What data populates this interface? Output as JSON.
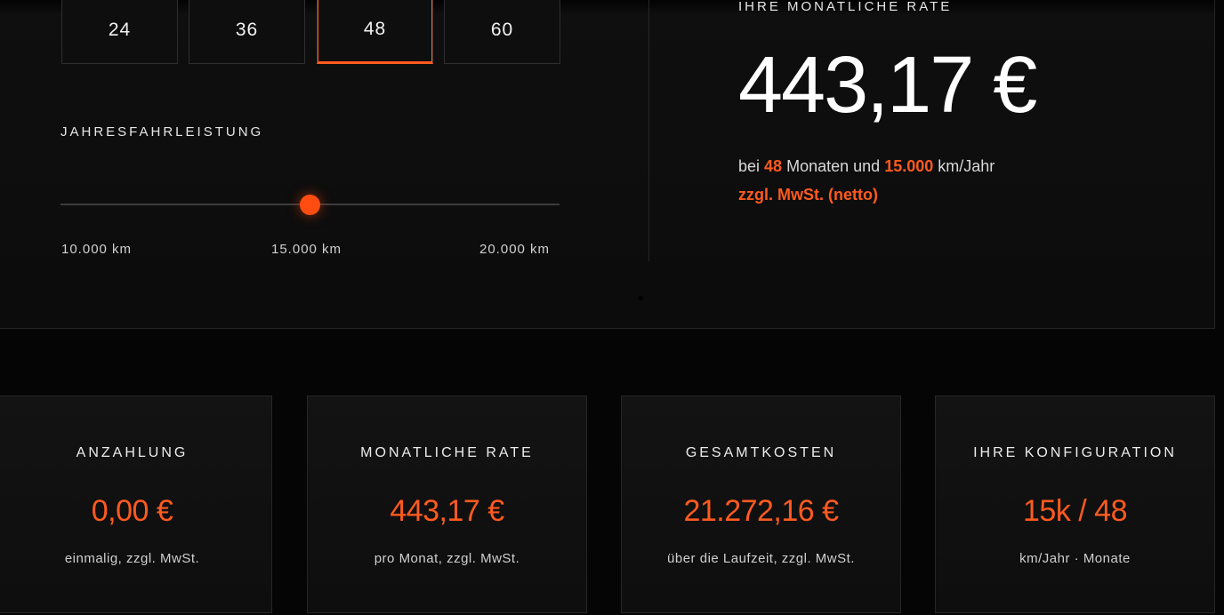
{
  "term": {
    "options": [
      "24",
      "36",
      "48",
      "60"
    ],
    "selected": "48"
  },
  "mileage": {
    "label": "JAHRESFAHRLEISTUNG",
    "ticks": [
      "10.000 km",
      "15.000 km",
      "20.000 km"
    ],
    "value_fraction": 0.5
  },
  "rate": {
    "label": "IHRE MONATLICHE RATE",
    "value": "443,17 €",
    "sub_prefix": "bei",
    "sub_months": "48",
    "sub_mid": "Monaten und",
    "sub_km": "15.000",
    "sub_suffix": "km/Jahr",
    "note": "zzgl. MwSt. (netto)"
  },
  "cards": [
    {
      "title": "ANZAHLUNG",
      "value": "0,00 €",
      "caption": "einmalig, zzgl. MwSt."
    },
    {
      "title": "MONATLICHE RATE",
      "value": "443,17 €",
      "caption": "pro Monat, zzgl. MwSt."
    },
    {
      "title": "GESAMTKOSTEN",
      "value": "21.272,16 €",
      "caption": "über die Laufzeit, zzgl. MwSt."
    },
    {
      "title": "IHRE KONFIGURATION",
      "value": "15k / 48",
      "caption": "km/Jahr · Monate"
    }
  ],
  "colors": {
    "accent": "#ff5a1f",
    "background": "#050505",
    "panel": "#0e0e0e",
    "border": "#262626"
  }
}
